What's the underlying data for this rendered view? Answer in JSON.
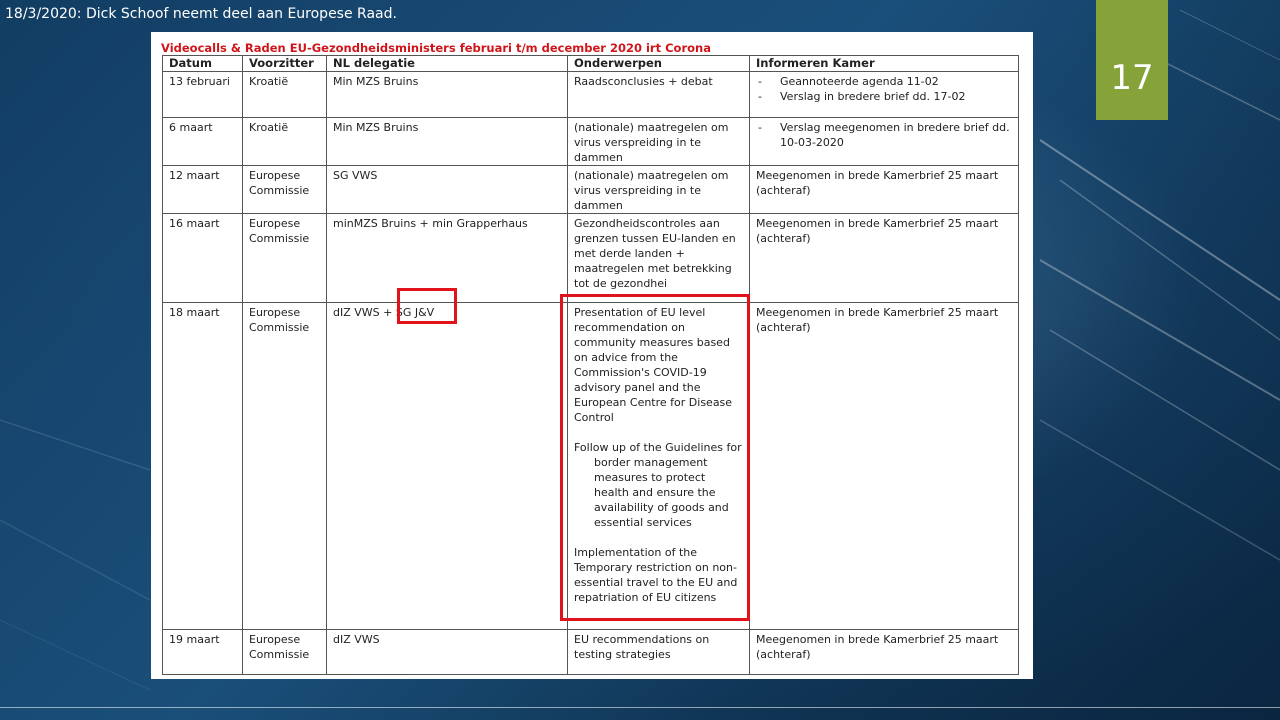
{
  "slide": {
    "caption": "18/3/2020: Dick Schoof neemt deel aan Europese Raad.",
    "page_number": "17",
    "colors": {
      "accent": "#86a33a",
      "highlight": "#e0121b",
      "doc_title": "#d0161b"
    }
  },
  "document": {
    "title": "Videocalls & Raden EU-Gezondheidsministers februari t/m december 2020 irt Corona",
    "headers": [
      "Datum",
      "Voorzitter",
      "NL delegatie",
      "Onderwerpen",
      "Informeren Kamer"
    ],
    "rows": [
      {
        "datum": "13 februari",
        "voorzitter": "Kroatië",
        "delegatie": "Min MZS Bruins",
        "onderwerpen": [
          "Raadsconclusies + debat"
        ],
        "informeren": [
          "Geannoteerde agenda 11-02",
          "Verslag in bredere brief dd. 17-02"
        ]
      },
      {
        "datum": "6 maart",
        "voorzitter": "Kroatië",
        "delegatie": "Min MZS Bruins",
        "onderwerpen": [
          "(nationale) maatregelen om virus verspreiding in te dammen"
        ],
        "informeren": [
          "Verslag meegenomen in bredere brief dd. 10-03-2020"
        ]
      },
      {
        "datum": "12 maart",
        "voorzitter": "Europese Commissie",
        "delegatie": "SG VWS",
        "onderwerpen": [
          "(nationale) maatregelen om virus verspreiding in te dammen"
        ],
        "informeren": [
          "Meegenomen in brede Kamerbrief 25 maart (achteraf)"
        ]
      },
      {
        "datum": "16 maart",
        "voorzitter": "Europese Commissie",
        "delegatie": "minMZS Bruins + min Grapperhaus",
        "onderwerpen": [
          "Gezondheidscontroles aan grenzen tussen EU-landen en met derde landen + maatregelen met betrekking tot de gezondhei"
        ],
        "informeren": [
          "Meegenomen in brede Kamerbrief 25 maart (achteraf)"
        ]
      },
      {
        "datum": "18 maart",
        "voorzitter": "Europese Commissie",
        "delegatie": "dIZ VWS + SG J&V",
        "onderwerpen": [
          "Presentation of EU level recommendation on community measures based on advice from the Commission's COVID-19 advisory panel and the European Centre for Disease Control",
          "Follow up of the Guidelines for border management measures to protect health and ensure the availability of goods and essential services",
          "Implementation of the Temporary restriction on non-essential travel to the EU and repatriation of EU citizens"
        ],
        "informeren": [
          "Meegenomen in brede Kamerbrief 25 maart (achteraf)"
        ]
      },
      {
        "datum": "19 maart",
        "voorzitter": "Europese Commissie",
        "delegatie": "dIZ VWS",
        "onderwerpen": [
          "EU recommendations on testing strategies"
        ],
        "informeren": [
          "Meegenomen in brede Kamerbrief 25 maart (achteraf)"
        ]
      }
    ]
  }
}
